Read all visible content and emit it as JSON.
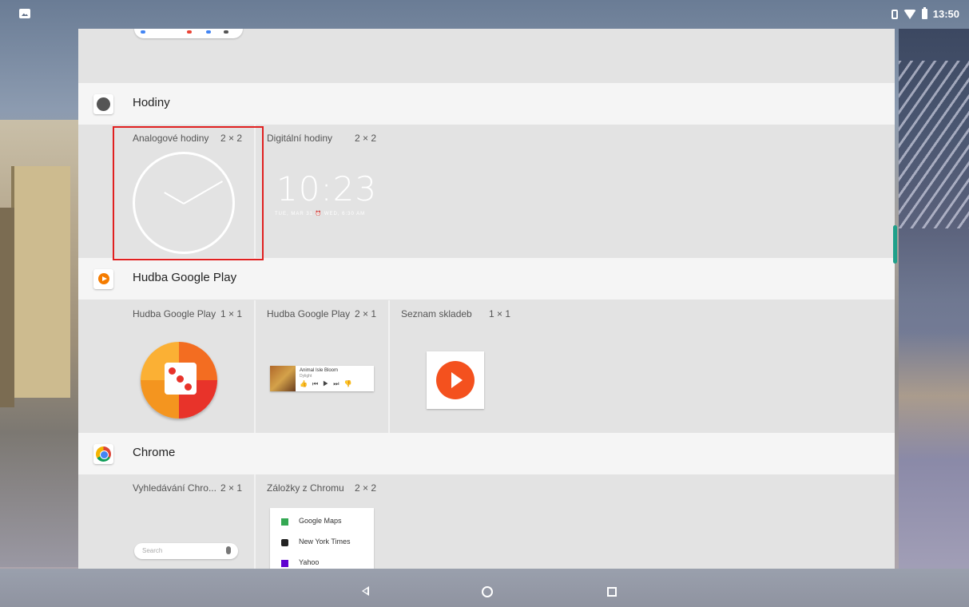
{
  "status_bar": {
    "time": "13:50"
  },
  "groups": {
    "clocks": {
      "title": "Hodiny",
      "widgets": [
        {
          "name": "Analogové hodiny",
          "size": "2 × 2"
        },
        {
          "name": "Digitální hodiny",
          "size": "2 × 2"
        }
      ],
      "digital_preview": {
        "time": "10:23",
        "subline": "TUE, MAR 31 ⏰ WED, 6:30 AM"
      }
    },
    "music": {
      "title": "Hudba Google Play",
      "widgets": [
        {
          "name": "Hudba Google Play",
          "size": "1 × 1"
        },
        {
          "name": "Hudba Google Play",
          "size": "2 × 1"
        },
        {
          "name": "Seznam skladeb",
          "size": "1 × 1"
        }
      ],
      "mini_player": {
        "title": "Animal Isle Bloom",
        "subtitle": "Dylight"
      }
    },
    "chrome": {
      "title": "Chrome",
      "widgets": [
        {
          "name": "Vyhledávání Chro...",
          "size": "2 × 1"
        },
        {
          "name": "Záložky z Chromu",
          "size": "2 × 2"
        }
      ],
      "search_placeholder": "Search",
      "bookmarks": [
        "Google Maps",
        "New York Times",
        "Yahoo"
      ]
    }
  },
  "colors": {
    "accent": "#20a08a",
    "highlight": "#e02020",
    "header_bg": "#f5f5f5",
    "panel_bg": "#e3e3e3"
  }
}
